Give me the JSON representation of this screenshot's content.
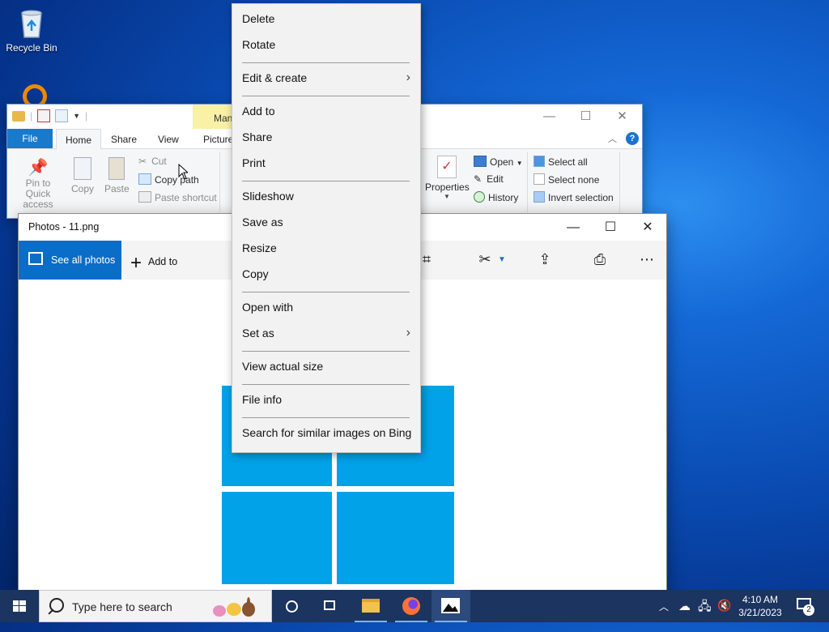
{
  "desktop": {
    "recycle_bin_label": "Recycle Bin"
  },
  "explorer": {
    "tabs": {
      "file": "File",
      "home": "Home",
      "share": "Share",
      "view": "View",
      "picture": "Picture",
      "manage_context": "Mana"
    },
    "ribbon": {
      "pin_line1": "Pin to Quick",
      "pin_line2": "access",
      "copy": "Copy",
      "paste": "Paste",
      "cut": "Cut",
      "copy_path": "Copy path",
      "paste_shortcut": "Paste shortcut",
      "properties": "Properties",
      "open": "Open",
      "edit": "Edit",
      "history": "History",
      "select_all": "Select all",
      "select_none": "Select none",
      "invert_selection": "Invert selection"
    }
  },
  "photos": {
    "title": "Photos - 11.png",
    "see_all_photos": "See all photos",
    "add_to": "Add to"
  },
  "context_menu": {
    "items": [
      "Delete",
      "Rotate",
      "Edit & create",
      "Add to",
      "Share",
      "Print",
      "Slideshow",
      "Save as",
      "Resize",
      "Copy",
      "Open with",
      "Set as",
      "View actual size",
      "File info",
      "Search for similar images on Bing"
    ]
  },
  "taskbar": {
    "search_placeholder": "Type here to search",
    "time": "4:10 AM",
    "date": "3/21/2023",
    "notification_count": "2"
  },
  "colors": {
    "accent": "#0a6dc8",
    "windows_logo": "#01a2e8",
    "taskbar": "#1b3460"
  }
}
